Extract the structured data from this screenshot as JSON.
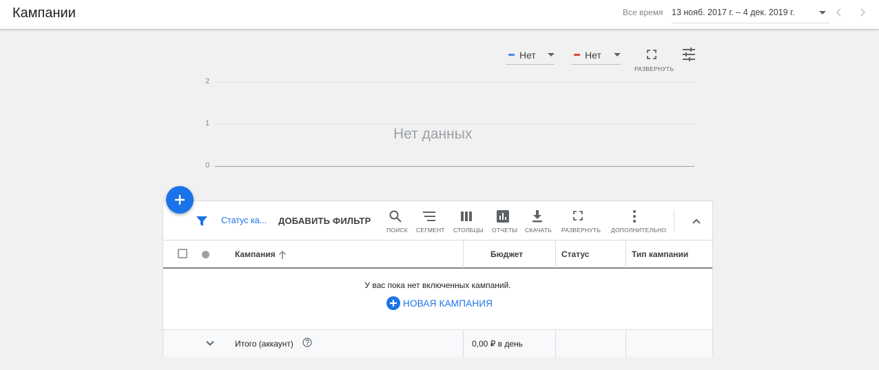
{
  "header": {
    "title": "Кампании",
    "date_range_label": "Все время",
    "date_range_value": "13 нояб. 2017 г. – 4 дек. 2019 г.",
    "prev_icon": "chevron-left-icon",
    "next_icon": "chevron-right-icon"
  },
  "chart_controls": {
    "metric1": {
      "label": "Нет",
      "color": "#4285f4"
    },
    "metric2": {
      "label": "Нет",
      "color": "#db4437"
    },
    "expand_label": "РАЗВЕРНУТЬ",
    "adjust_icon": "tune-icon"
  },
  "chart_data": {
    "type": "line",
    "series": [],
    "ylim": [
      0,
      2
    ],
    "yticks": [
      "2",
      "1",
      "0"
    ],
    "empty_text": "Нет данных"
  },
  "toolbar": {
    "filter_text": "Статус ка...",
    "add_filter": "ДОБАВИТЬ ФИЛЬТР",
    "buttons": [
      {
        "label": "ПОИСК",
        "icon": "search-icon"
      },
      {
        "label": "СЕГМЕНТ",
        "icon": "segment-icon"
      },
      {
        "label": "СТОЛБЦЫ",
        "icon": "columns-icon"
      },
      {
        "label": "ОТЧЕТЫ",
        "icon": "reports-icon"
      },
      {
        "label": "СКАЧАТЬ",
        "icon": "download-icon"
      },
      {
        "label": "РАЗВЕРНУТЬ",
        "icon": "fullscreen-icon"
      },
      {
        "label": "ДОПОЛНИТЕЛЬНО",
        "icon": "more-vert-icon"
      }
    ]
  },
  "table": {
    "columns": [
      "Кампания",
      "Бюджет",
      "Статус",
      "Тип кампании"
    ],
    "empty_message": "У вас пока нет включенных кампаний.",
    "new_campaign": "НОВАЯ КАМПАНИЯ",
    "total_label": "Итого (аккаунт)",
    "total_budget": "0,00 ₽ в день"
  },
  "colors": {
    "accent": "#1a73e8",
    "background": "#f1f1f1"
  }
}
